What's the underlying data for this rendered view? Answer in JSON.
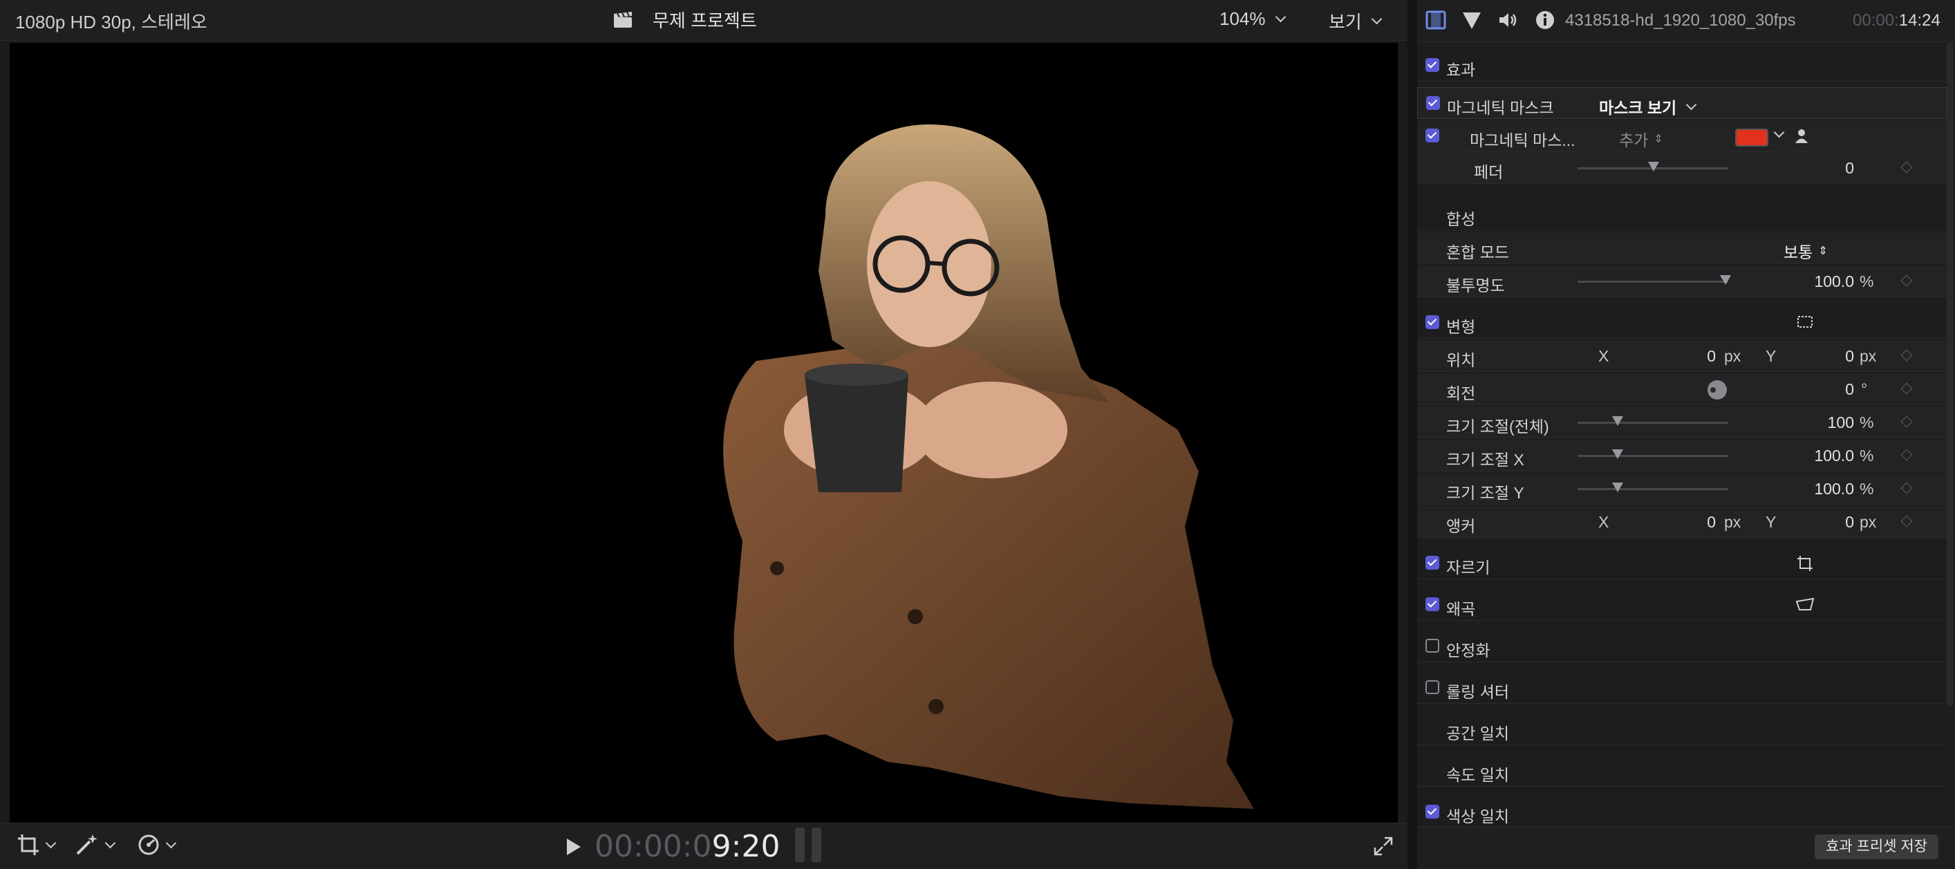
{
  "viewer": {
    "format_label": "1080p HD 30p, 스테레오",
    "project_title": "무제 프로젝트",
    "zoom_label": "104%",
    "view_label": "보기",
    "timecode_dim": "00:00:0",
    "timecode_bright": "9:20"
  },
  "inspector": {
    "clip_name": "4318518-hd_1920_1080_30fps",
    "timecode_dim": "00:00:",
    "timecode_bright": "14:24",
    "effects_label": "효과",
    "magnetic_mask_label": "마그네틱 마스크",
    "show_mask_label": "마스크 보기",
    "magnetic_mask_sub_label": "마그네틱 마스...",
    "add_label": "추가",
    "mask_color": "#e2321e",
    "feather_label": "페더",
    "feather_value": "0",
    "compositing_label": "합성",
    "blend_mode_label": "혼합 모드",
    "blend_mode_value": "보통",
    "opacity_label": "불투명도",
    "opacity_value": "100.0",
    "opacity_unit": "%",
    "transform_label": "변형",
    "position_label": "위치",
    "position_x_axis": "X",
    "position_x_value": "0",
    "position_x_unit": "px",
    "position_y_axis": "Y",
    "position_y_value": "0",
    "position_y_unit": "px",
    "rotation_label": "회전",
    "rotation_value": "0",
    "rotation_unit": "°",
    "scale_all_label": "크기 조절(전체)",
    "scale_all_value": "100",
    "scale_all_unit": "%",
    "scale_x_label": "크기 조절 X",
    "scale_x_value": "100.0",
    "scale_x_unit": "%",
    "scale_y_label": "크기 조절 Y",
    "scale_y_value": "100.0",
    "scale_y_unit": "%",
    "anchor_label": "앵커",
    "anchor_x_axis": "X",
    "anchor_x_value": "0",
    "anchor_x_unit": "px",
    "anchor_y_axis": "Y",
    "anchor_y_value": "0",
    "anchor_y_unit": "px",
    "crop_label": "자르기",
    "distort_label": "왜곡",
    "stabilization_label": "안정화",
    "rolling_shutter_label": "롤링 셔터",
    "spatial_conform_label": "공간 일치",
    "rate_conform_label": "속도 일치",
    "color_conform_label": "색상 일치",
    "save_preset_label": "효과 프리셋 저장"
  },
  "colors": {
    "accent": "#5b5bd6",
    "mask_red": "#e2321e",
    "background": "#1d1d1f"
  }
}
